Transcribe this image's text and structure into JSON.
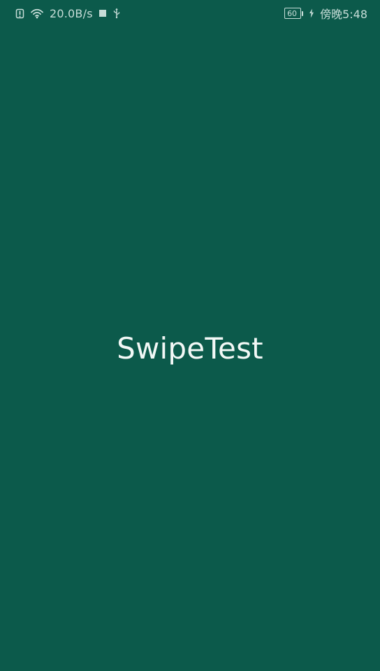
{
  "status_bar": {
    "alert_icon": "alert-icon",
    "wifi_icon": "wifi-icon",
    "network_speed": "20.0B/s",
    "square_icon": "square-icon",
    "usb_icon": "usb-icon",
    "battery_level": "60",
    "charging_icon": "charging-icon",
    "time": "傍晚5:48"
  },
  "main": {
    "title": "SwipeTest"
  },
  "colors": {
    "background": "#0c5a4b",
    "text": "#e6f2ef"
  }
}
